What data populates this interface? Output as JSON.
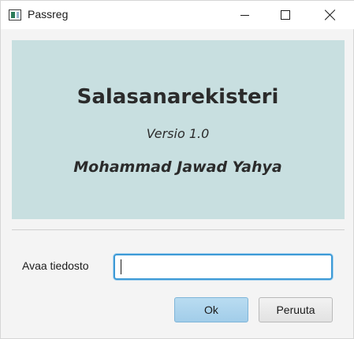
{
  "window": {
    "title": "Passreg",
    "controls": {
      "minimize": "minimize-icon",
      "maximize": "maximize-icon",
      "close": "close-icon"
    }
  },
  "banner": {
    "app_name": "Salasanarekisteri",
    "version": "Versio 1.0",
    "author": "Mohammad Jawad Yahya",
    "background_color": "#c8dfe0"
  },
  "form": {
    "file_label": "Avaa tiedosto",
    "file_value": ""
  },
  "buttons": {
    "ok_label": "Ok",
    "cancel_label": "Peruuta"
  },
  "colors": {
    "focus_border": "#3d9ad6",
    "default_button": "#a2cde9"
  }
}
